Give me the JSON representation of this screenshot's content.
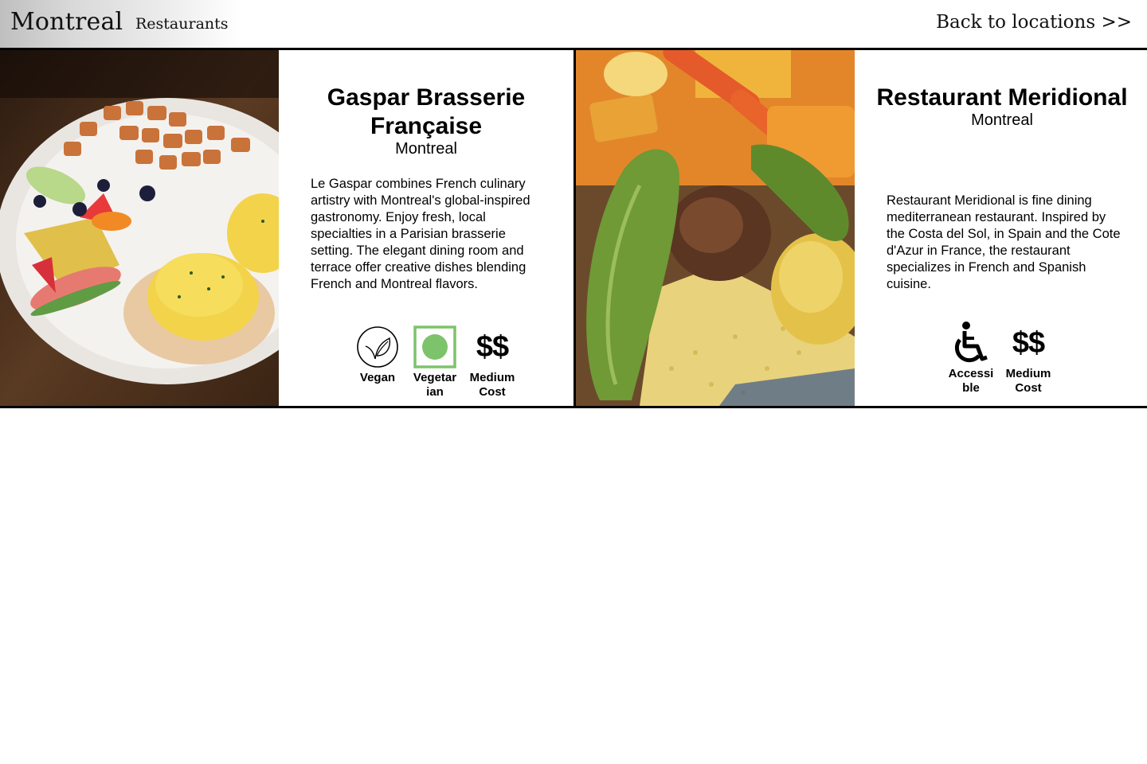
{
  "header": {
    "city": "Montreal",
    "section": "Restaurants",
    "back_link": "Back to locations >>"
  },
  "restaurants": [
    {
      "name": "Gaspar Brasserie Française",
      "city": "Montreal",
      "description": "Le Gaspar combines French culinary artistry with Montreal's global-inspired gastronomy. Enjoy fresh, local specialties in a Parisian brasserie setting. The elegant dining room and terrace offer creative dishes blending French and Montreal flavors.",
      "image_icon": "eggs-benedict-plate-image",
      "badges": [
        {
          "icon": "leaf-icon",
          "label": "Vegan"
        },
        {
          "icon": "vegetarian-mark-icon",
          "label": "Vegetar ian",
          "color": "#7dc36b"
        },
        {
          "icon": "dollar-icon",
          "symbol": "$$",
          "label": "Medium Cost"
        }
      ]
    },
    {
      "name": "Restaurant Meridional",
      "city": "Montreal",
      "description": "Restaurant Meridional is fine dining mediterranean restaurant. Inspired by the Costa del Sol, in Spain and the Cote d'Azur in France, the restaurant specializes in French and Spanish cuisine.",
      "image_icon": "couscous-vegetables-image",
      "badges": [
        {
          "icon": "wheelchair-icon",
          "label": "Accessi ble"
        },
        {
          "icon": "dollar-icon",
          "symbol": "$$",
          "label": "Medium Cost"
        }
      ]
    }
  ]
}
